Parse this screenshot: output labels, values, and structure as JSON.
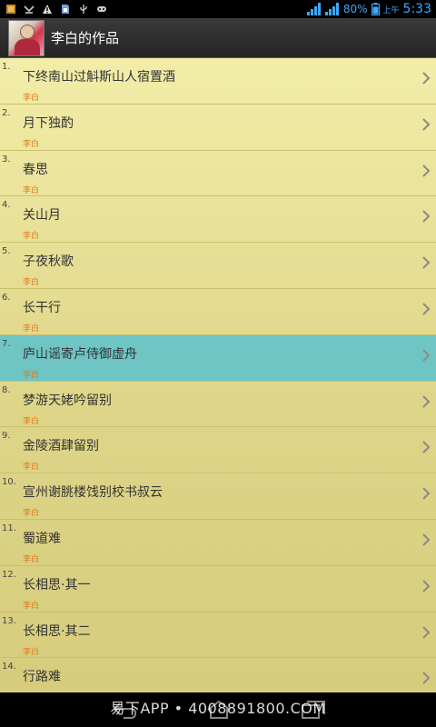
{
  "status_bar": {
    "battery_percent": "80%",
    "ampm": "上午",
    "time": "5:33",
    "accent_color": "#3fa8ff"
  },
  "header": {
    "title": "李白的作品"
  },
  "poems": [
    {
      "index": "1.",
      "title": "下终南山过斛斯山人宿置酒",
      "author": "李白"
    },
    {
      "index": "2.",
      "title": "月下独酌",
      "author": "李白"
    },
    {
      "index": "3.",
      "title": "春思",
      "author": "李白"
    },
    {
      "index": "4.",
      "title": "关山月",
      "author": "李白"
    },
    {
      "index": "5.",
      "title": "子夜秋歌",
      "author": "李白"
    },
    {
      "index": "6.",
      "title": "长干行",
      "author": "李白"
    },
    {
      "index": "7.",
      "title": "庐山谣寄卢侍御虚舟",
      "author": "李白",
      "selected": true
    },
    {
      "index": "8.",
      "title": "梦游天姥吟留别",
      "author": "李白"
    },
    {
      "index": "9.",
      "title": "金陵酒肆留别",
      "author": "李白"
    },
    {
      "index": "10.",
      "title": "宣州谢朓楼饯别校书叔云",
      "author": "李白"
    },
    {
      "index": "11.",
      "title": "蜀道难",
      "author": "李白"
    },
    {
      "index": "12.",
      "title": "长相思·其一",
      "author": "李白"
    },
    {
      "index": "13.",
      "title": "长相思·其二",
      "author": "李白"
    },
    {
      "index": "14.",
      "title": "行路难",
      "author": ""
    }
  ],
  "watermark": "易下APP • 4008891800.COM",
  "colors": {
    "list_bg": "#e8e09a",
    "selected_bg": "#6fc4c4",
    "author_text": "#e07a1a"
  }
}
